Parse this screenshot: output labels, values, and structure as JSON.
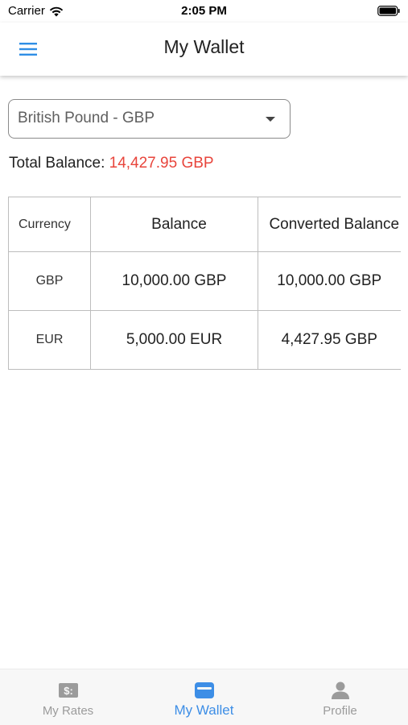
{
  "status_bar": {
    "carrier": "Carrier",
    "time": "2:05 PM",
    "icons": [
      "wifi-icon",
      "battery-icon"
    ]
  },
  "app_bar": {
    "title": "My Wallet",
    "menu_icon": "menu-icon"
  },
  "currency_select": {
    "selected": "British Pound - GBP",
    "icon": "dropdown-arrow-icon"
  },
  "total_balance": {
    "label": "Total Balance:",
    "value": "14,427.95 GBP",
    "value_color": "#e8453c"
  },
  "table": {
    "headers": [
      "Currency",
      "Balance",
      "Converted Balance"
    ],
    "rows": [
      {
        "currency": "GBP",
        "balance": "10,000.00 GBP",
        "converted": "10,000.00 GBP"
      },
      {
        "currency": "EUR",
        "balance": "5,000.00 EUR",
        "converted": "4,427.95 GBP"
      }
    ]
  },
  "tab_bar": {
    "tabs": [
      {
        "label": "My Rates",
        "icon": "rates-icon",
        "active": false
      },
      {
        "label": "My Wallet",
        "icon": "wallet-icon",
        "active": true
      },
      {
        "label": "Profile",
        "icon": "profile-icon",
        "active": false
      }
    ],
    "active_color": "#3d8ee6",
    "inactive_color": "#9b9b9b"
  }
}
